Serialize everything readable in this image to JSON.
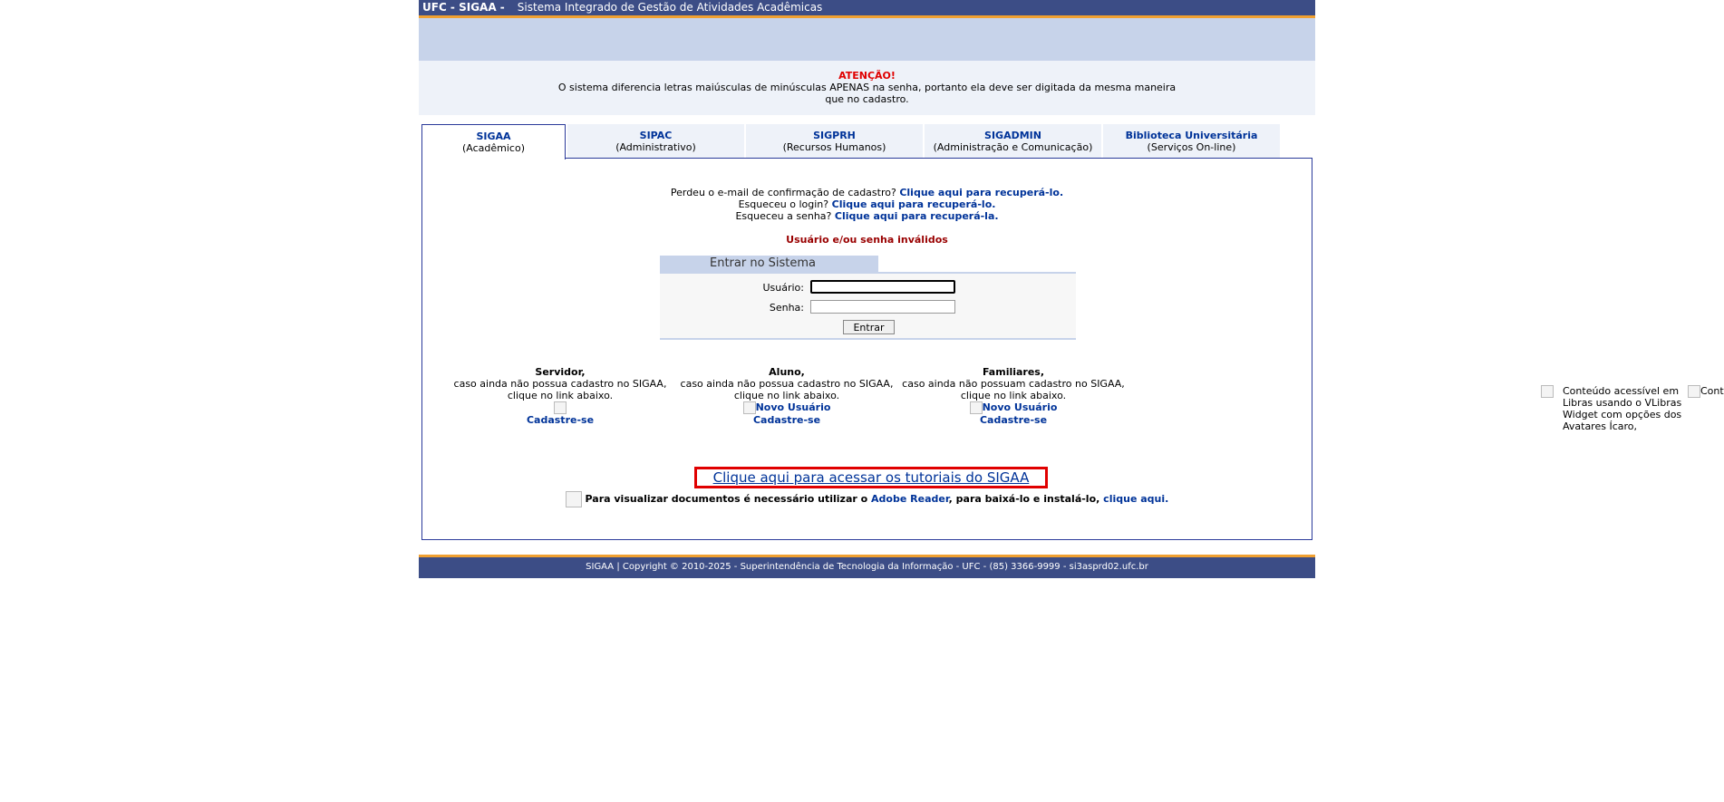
{
  "header": {
    "system": "UFC - SIGAA -",
    "description": "Sistema Integrado de Gestão de Atividades Acadêmicas"
  },
  "notice": {
    "title": "ATENÇÃO!",
    "line1": "O sistema diferencia letras maiúsculas de minúsculas APENAS na senha, portanto ela deve ser digitada da mesma maneira",
    "line2": "que no cadastro."
  },
  "tabs": [
    {
      "name": "SIGAA",
      "sub": "(Acadêmico)"
    },
    {
      "name": "SIPAC",
      "sub": "(Administrativo)"
    },
    {
      "name": "SIGPRH",
      "sub": "(Recursos Humanos)"
    },
    {
      "name": "SIGADMIN",
      "sub": "(Administração e Comunicação)"
    },
    {
      "name": "Biblioteca Universitária",
      "sub": "(Serviços On-line)"
    }
  ],
  "recovery": {
    "email_text": "Perdeu o e-mail de confirmação de cadastro?",
    "email_link": "Clique aqui para recuperá-lo.",
    "login_text": "Esqueceu o login?",
    "login_link": "Clique aqui para recuperá-lo.",
    "senha_text": "Esqueceu a senha?",
    "senha_link": "Clique aqui para recuperá-la."
  },
  "error": "Usuário e/ou senha inválidos",
  "login": {
    "title": "Entrar no Sistema",
    "user_label": "Usuário:",
    "user_value": "",
    "pass_label": "Senha:",
    "pass_value": "",
    "submit": "Entrar"
  },
  "cadastro": [
    {
      "title": "Servidor,",
      "line1": "caso ainda não possua cadastro no SIGAA,",
      "line2": "clique no link abaixo.",
      "img_alt": "",
      "link": "Cadastre-se"
    },
    {
      "title": "Aluno,",
      "line1": "caso ainda não possua cadastro no SIGAA,",
      "line2": "clique no link abaixo.",
      "img_alt": "Novo Usuário",
      "link": "Cadastre-se"
    },
    {
      "title": "Familiares,",
      "line1": "caso ainda não possuam cadastro no SIGAA,",
      "line2": "clique no link abaixo.",
      "img_alt": "Novo Usuário",
      "link": "Cadastre-se"
    }
  ],
  "tutorial_link": "Clique aqui para acessar os tutoriais do SIGAA",
  "pdf": {
    "text1": "Para visualizar documentos é necessário utilizar o",
    "adobe": "Adobe Reader",
    "text2": ", para baixá-lo e instalá-lo,",
    "link": "clique aqui."
  },
  "footer": "SIGAA | Copyright © 2010-2025 - Superintendência de Tecnologia da Informação - UFC - (85) 3366-9999 - si3asprd02.ufc.br",
  "vlibras": {
    "text": "Conteúdo acessível em Libras usando o VLibras Widget com opções dos Avatares Ícaro,",
    "text2": "Conteúdo acessível"
  },
  "colors": {
    "header_bg": "#3c4d86",
    "accent_orange": "#f0a030",
    "banner_bg": "#c7d3ea",
    "link": "#003399",
    "error": "#990000",
    "tutorial_border": "#e00000"
  }
}
